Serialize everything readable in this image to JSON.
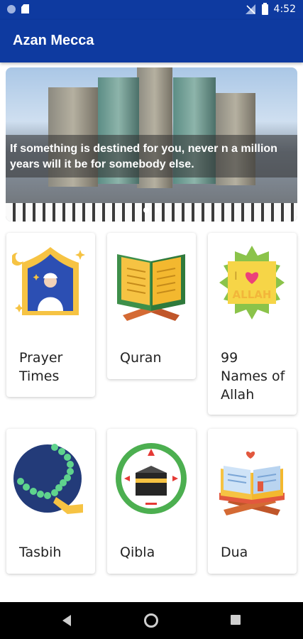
{
  "status_bar": {
    "time": "4:52",
    "icons": [
      "notification-dot-icon",
      "sd-card-icon",
      "no-signal-icon",
      "battery-icon"
    ]
  },
  "app_bar": {
    "title": "Azan Mecca"
  },
  "banner": {
    "caption": "If something is destined for you, never n a million years will it be for somebody else.",
    "pager": {
      "count": 2,
      "active": 1
    }
  },
  "grid": {
    "items": [
      {
        "label": "Prayer Times",
        "icon": "mosque-prayer-icon"
      },
      {
        "label": "Quran",
        "icon": "quran-book-icon"
      },
      {
        "label": "99 Names of Allah",
        "icon": "i-love-allah-icon"
      },
      {
        "label": "Tasbih",
        "icon": "tasbih-beads-icon"
      },
      {
        "label": "Qibla",
        "icon": "kaaba-compass-icon"
      },
      {
        "label": "Dua",
        "icon": "dua-book-icon"
      }
    ]
  },
  "colors": {
    "primary": "#0e3aa0",
    "gold": "#f6c343",
    "green": "#4caf50"
  }
}
